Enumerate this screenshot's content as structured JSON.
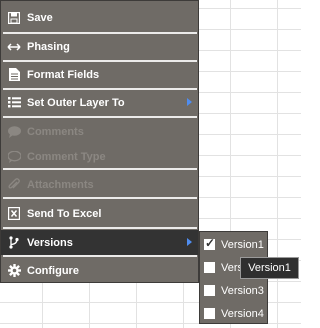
{
  "menu": {
    "items": [
      {
        "label": "Save",
        "icon": "save-icon",
        "disabled": false
      },
      {
        "label": "Phasing",
        "icon": "double-arrow-icon",
        "disabled": false
      },
      {
        "label": "Format Fields",
        "icon": "document-icon",
        "disabled": false
      },
      {
        "label": "Set Outer Layer To",
        "icon": "list-icon",
        "disabled": false,
        "has_submenu": true
      },
      {
        "label": "Comments",
        "icon": "comment-icon",
        "disabled": true
      },
      {
        "label": "Comment Type",
        "icon": "comment-type-icon",
        "disabled": true
      },
      {
        "label": "Attachments",
        "icon": "paperclip-icon",
        "disabled": true
      },
      {
        "label": "Send To Excel",
        "icon": "excel-icon",
        "disabled": false
      },
      {
        "label": "Versions",
        "icon": "branch-icon",
        "disabled": false,
        "has_submenu": true,
        "active": true
      },
      {
        "label": "Configure",
        "icon": "gear-icon",
        "disabled": false
      }
    ]
  },
  "versions_submenu": {
    "items": [
      {
        "label": "Version1",
        "checked": true
      },
      {
        "label": "Version2",
        "checked": false
      },
      {
        "label": "Version3",
        "checked": false
      },
      {
        "label": "Version4",
        "checked": false
      }
    ]
  },
  "tooltip": {
    "text": "Version1"
  },
  "colors": {
    "menu_bg": "#6f6b66",
    "active_bg": "#333333",
    "submenu_arrow": "#4f8df0"
  }
}
